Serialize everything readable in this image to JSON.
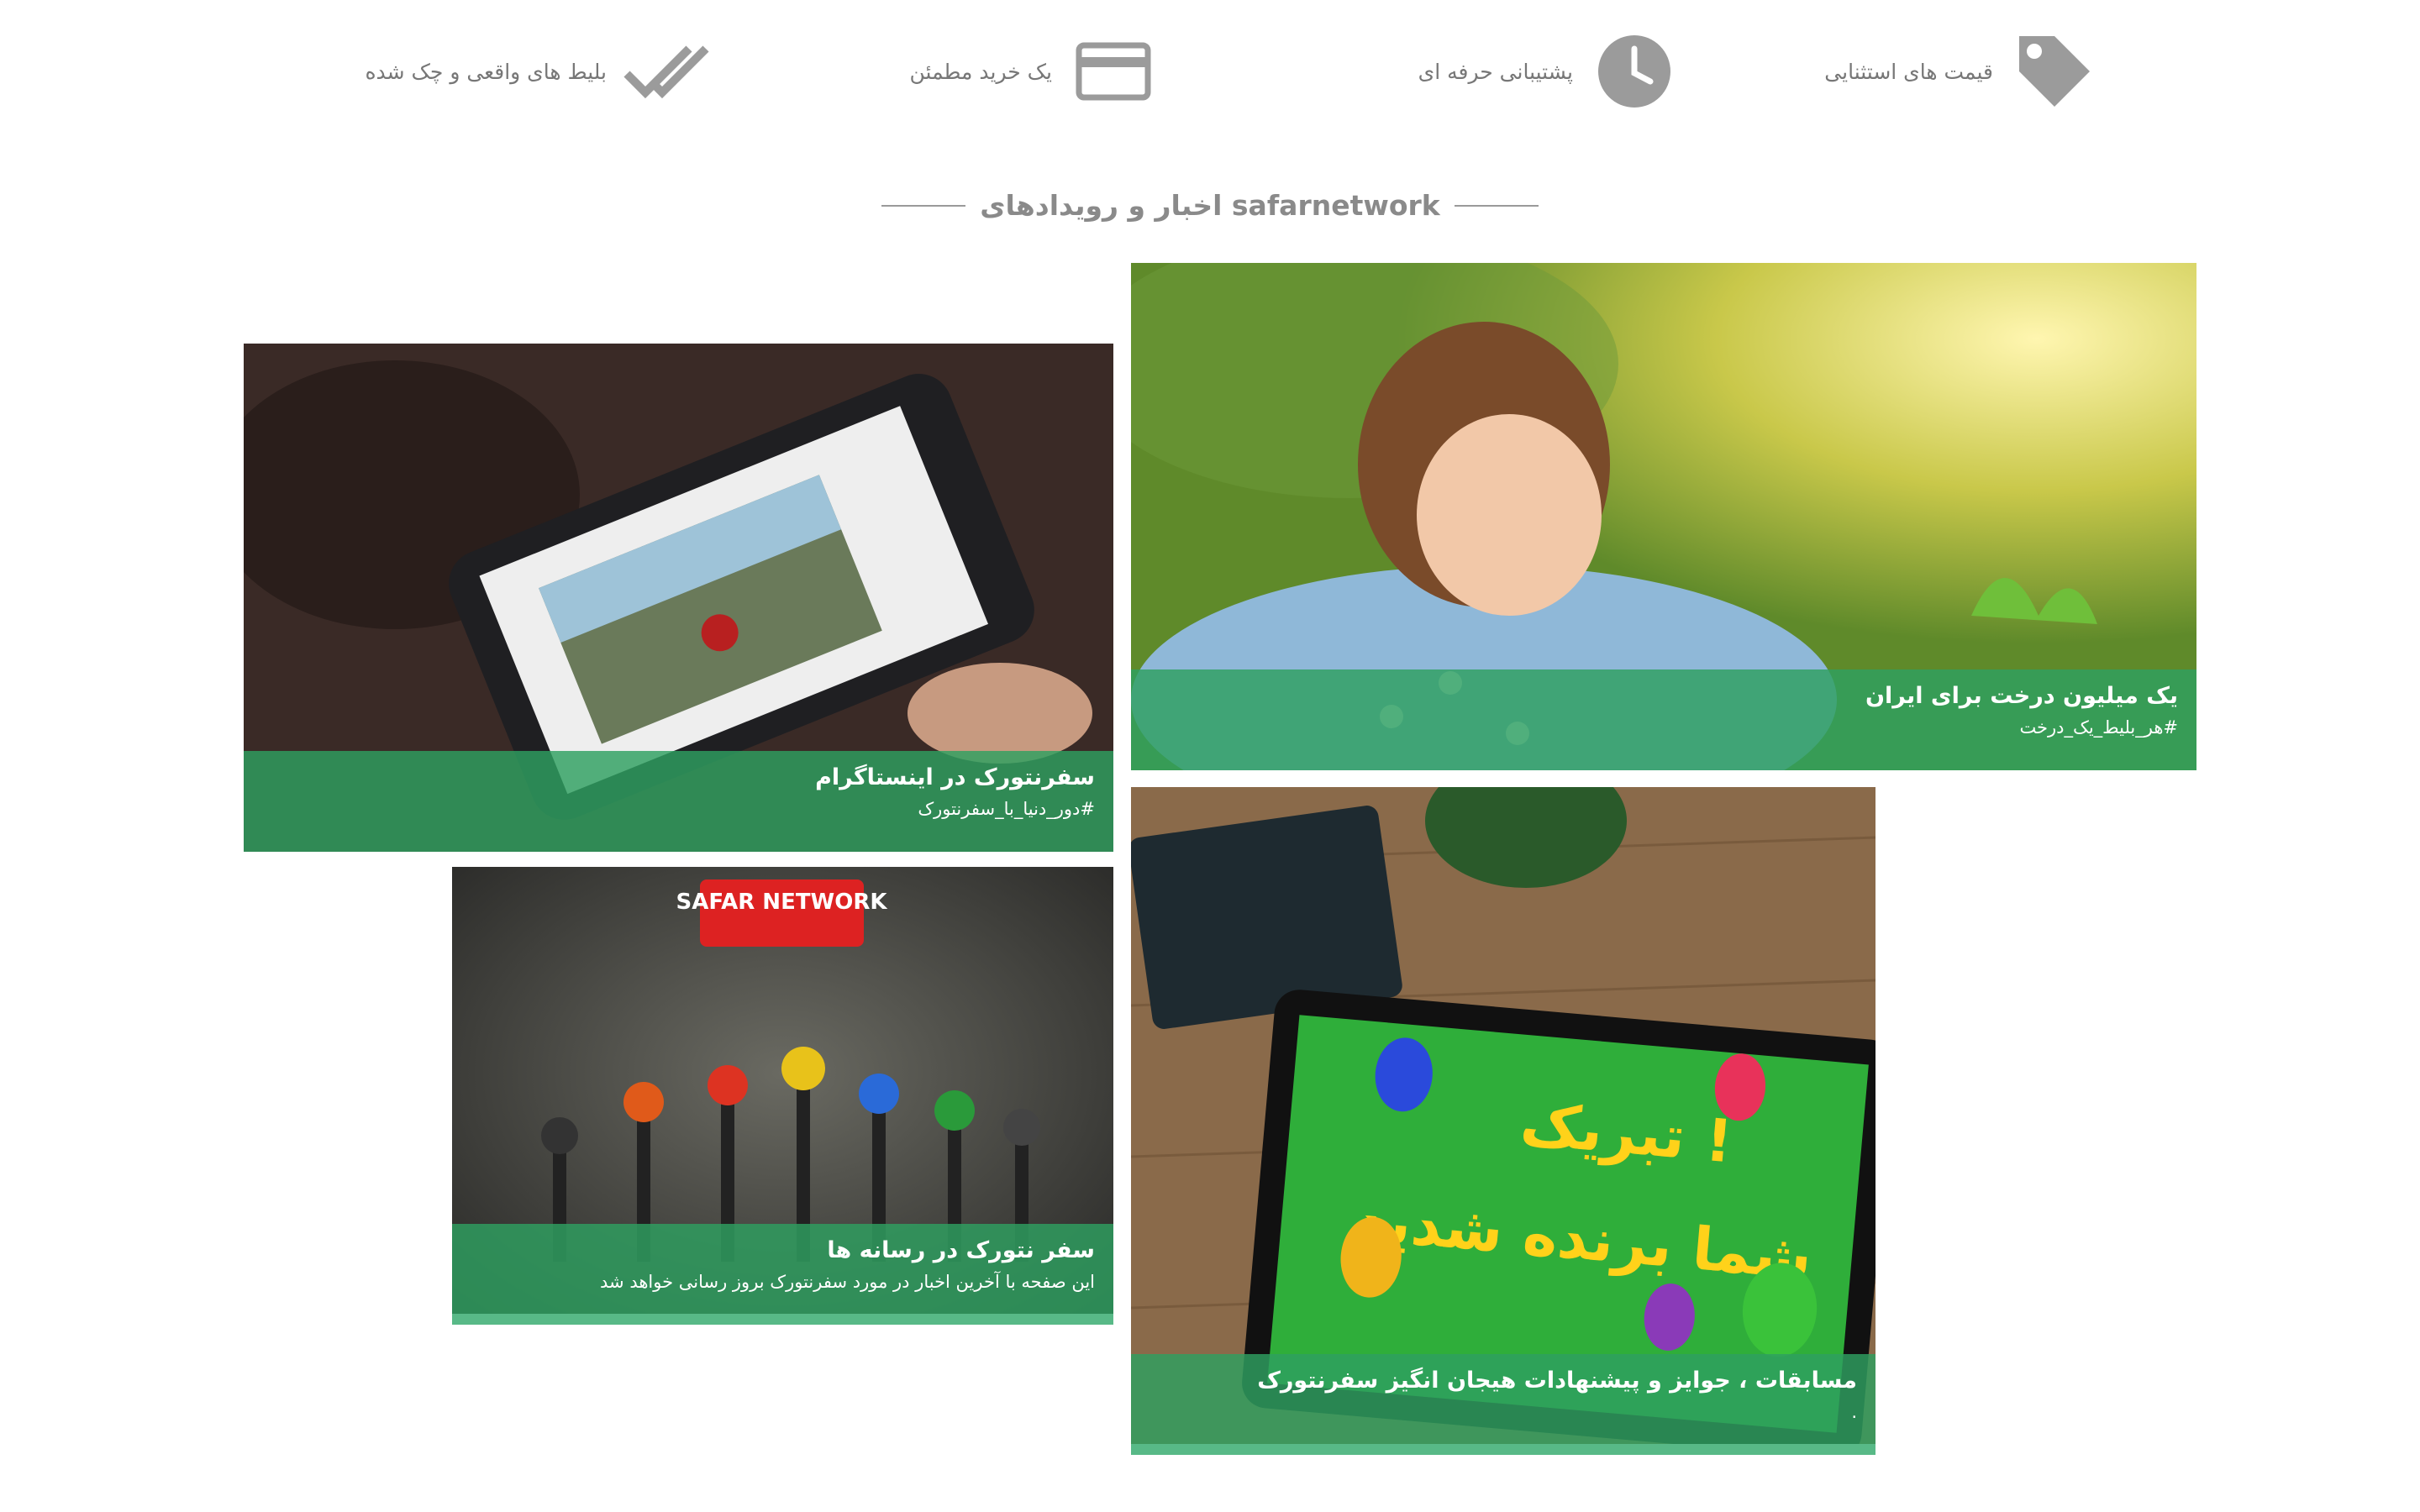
{
  "features": [
    {
      "label": "قیمت های استثنایی",
      "icon": "tag-icon"
    },
    {
      "label": "پشتیبانی حرفه ای",
      "icon": "clock-icon"
    },
    {
      "label": "یک خرید مطمئن",
      "icon": "credit-card-icon"
    },
    {
      "label": "بلیط های واقعی و چک شده",
      "icon": "double-check-icon"
    }
  ],
  "section": {
    "title": "اخبار و رویدادهای safarnetwork"
  },
  "cards": {
    "tree": {
      "title": "یک میلیون درخت برای ایران",
      "subtitle": "#هر_بلیط_یک_درخت"
    },
    "instagram": {
      "title": "سفرنتورک در اینستاگرام",
      "subtitle": "#دور_دنیا_با_سفرنتورک"
    },
    "media": {
      "title": "سفر نتورک در رسانه ها",
      "subtitle": "این صفحه با آخرین اخبار در مورد سفرنتورک بروز رسانی خواهد شد",
      "sign": "SAFAR NETWORK"
    },
    "contest": {
      "title": "مسابقات ، جوایز و پیشنهادات هیجان انگیز سفرنتورک",
      "subtitle": ".",
      "tablet_line1": "تبریک !",
      "tablet_line2": "شما برنده شدید"
    }
  },
  "colors": {
    "accent_green": "#2ea060",
    "icon_gray": "#9b9b9b"
  }
}
